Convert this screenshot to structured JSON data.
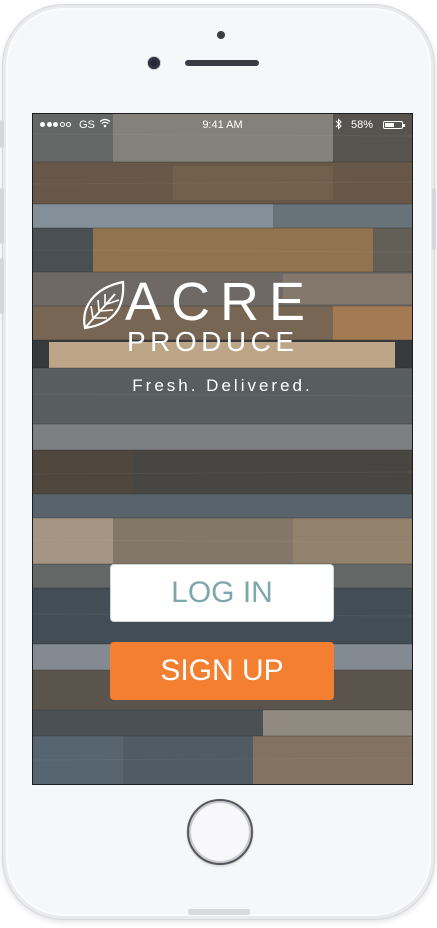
{
  "status_bar": {
    "carrier": "GS",
    "time": "9:41 AM",
    "battery_percent": "58%",
    "battery_level": 0.58,
    "signal_strength": 3,
    "icons": [
      "signal-dots-icon",
      "wifi-icon",
      "bluetooth-icon",
      "battery-icon"
    ]
  },
  "brand": {
    "logo_icon": "leaf-icon",
    "name_line1": "ACRE",
    "name_line2": "PRODUCE",
    "tagline": "Fresh. Delivered."
  },
  "actions": {
    "login_label": "LOG IN",
    "signup_label": "SIGN UP"
  },
  "colors": {
    "signup_bg": "#f57f31",
    "login_text": "#7ea7ac",
    "login_bg": "#ffffff"
  },
  "device": {
    "home_button": "home-button",
    "background": "wood-planks"
  }
}
